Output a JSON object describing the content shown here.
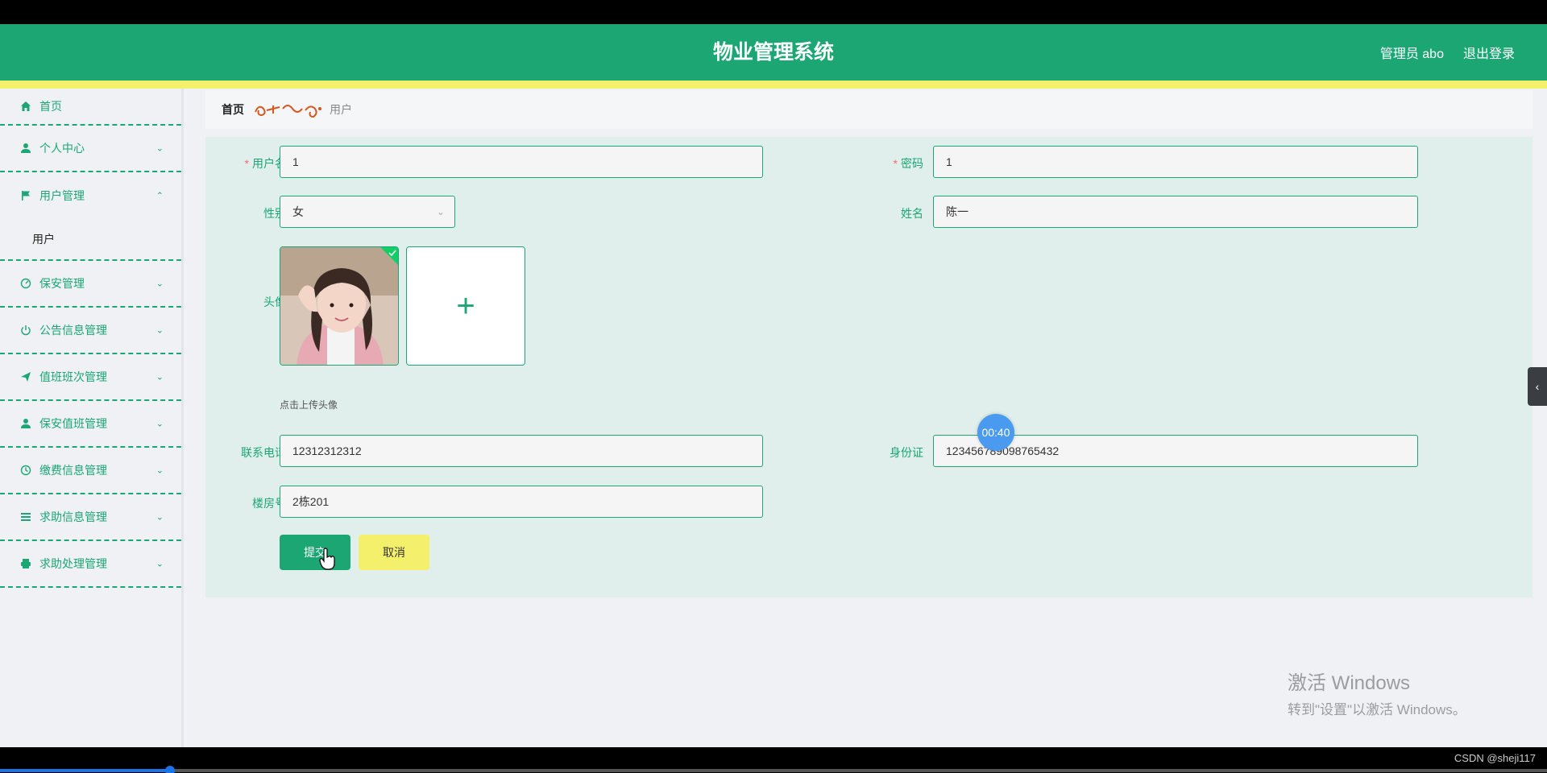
{
  "header": {
    "title": "物业管理系统",
    "user": "管理员 abo",
    "logout": "退出登录",
    "color": "#1ba673",
    "accent": "#f5f06c"
  },
  "sidebar": {
    "items": [
      {
        "label": "首页",
        "icon": "home-icon"
      },
      {
        "label": "个人中心",
        "icon": "user-icon"
      },
      {
        "label": "用户管理",
        "icon": "flag-icon"
      },
      {
        "label": "保安管理",
        "icon": "gauge-icon"
      },
      {
        "label": "公告信息管理",
        "icon": "power-icon"
      },
      {
        "label": "值班班次管理",
        "icon": "send-icon"
      },
      {
        "label": "保安值班管理",
        "icon": "person-icon"
      },
      {
        "label": "缴费信息管理",
        "icon": "clock-icon"
      },
      {
        "label": "求助信息管理",
        "icon": "list-icon"
      },
      {
        "label": "求助处理管理",
        "icon": "printer-icon"
      }
    ],
    "submenu_label": "用户"
  },
  "breadcrumb": {
    "home": "首页",
    "current": "用户"
  },
  "form": {
    "username_label": "用户名",
    "username_value": "1",
    "password_label": "密码",
    "password_value": "1",
    "gender_label": "性别",
    "gender_value": "女",
    "name_label": "姓名",
    "name_value": "陈一",
    "avatar_label": "头像",
    "avatar_tip": "点击上传头像",
    "phone_label": "联系电话",
    "phone_value": "12312312312",
    "idcard_label": "身份证",
    "idcard_value": "123456789098765432",
    "room_label": "楼房号",
    "room_value": "2栋201",
    "submit_label": "提交",
    "cancel_label": "取消"
  },
  "overlay": {
    "timer": "00:40",
    "watermark_line1": "激活 Windows",
    "watermark_line2": "转到\"设置\"以激活 Windows。",
    "credit": "CSDN @sheji117"
  },
  "video_progress": 0.11
}
